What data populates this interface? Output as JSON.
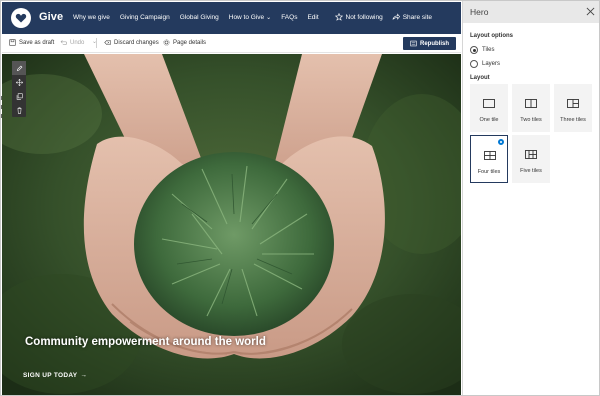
{
  "site": {
    "title": "Give",
    "nav": [
      {
        "label": "Why we give",
        "has_dropdown": false
      },
      {
        "label": "Giving Campaign",
        "has_dropdown": false
      },
      {
        "label": "Global Giving",
        "has_dropdown": false
      },
      {
        "label": "How to Give",
        "has_dropdown": true
      },
      {
        "label": "FAQs",
        "has_dropdown": false
      },
      {
        "label": "Edit",
        "has_dropdown": false
      }
    ],
    "actions": {
      "follow_label": "Not following",
      "share_label": "Share site"
    },
    "colors": {
      "header_bg": "#243a5e",
      "accent": "#0078d4"
    }
  },
  "command_bar": {
    "save_draft": "Save as draft",
    "undo": "Undo",
    "discard": "Discard changes",
    "page_details": "Page details",
    "republish": "Republish"
  },
  "hero": {
    "title": "Community empowerment around the world",
    "cta": "SIGN UP TODAY",
    "cta_arrow": "→",
    "image_description_icon": "hands-holding-pine-icon"
  },
  "pane": {
    "title": "Hero",
    "layout_options_heading": "Layout options",
    "layout_options": [
      {
        "label": "Tiles",
        "checked": true
      },
      {
        "label": "Layers",
        "checked": false
      }
    ],
    "layout_heading": "Layout",
    "tiles": [
      {
        "label": "One tile",
        "selected": false
      },
      {
        "label": "Two tiles",
        "selected": false
      },
      {
        "label": "Three tiles",
        "selected": false
      },
      {
        "label": "Four tiles",
        "selected": true
      },
      {
        "label": "Five tiles",
        "selected": false
      }
    ]
  }
}
